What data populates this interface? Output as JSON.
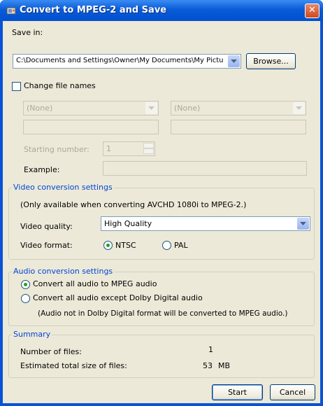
{
  "window": {
    "title": "Convert to MPEG-2 and Save"
  },
  "save_in": {
    "label": "Save in:",
    "path": "C:\\Documents and Settings\\Owner\\My Documents\\My Pictu",
    "browse_label": "Browse..."
  },
  "change_names": {
    "label": "Change file names",
    "checked": false
  },
  "naming": {
    "combo1_value": "(None)",
    "combo2_value": "(None)",
    "starting_number_label": "Starting number:",
    "starting_number_value": "1",
    "example_label": "Example:"
  },
  "video": {
    "group_label": "Video conversion settings",
    "note": "(Only available when converting AVCHD 1080i to MPEG-2.)",
    "quality_label": "Video quality:",
    "quality_value": "High Quality",
    "format_label": "Video format:",
    "ntsc_label": "NTSC",
    "pal_label": "PAL",
    "selected_format": "NTSC"
  },
  "audio": {
    "group_label": "Audio conversion settings",
    "option1_label": "Convert all audio to MPEG audio",
    "option2_label": "Convert all audio except Dolby Digital audio",
    "note": "(Audio not in Dolby Digital format will be converted to MPEG audio.)",
    "selected": "option1"
  },
  "summary": {
    "group_label": "Summary",
    "files_label": "Number of files:",
    "files_value": "1",
    "size_label": "Estimated total size of files:",
    "size_value": "53",
    "size_unit": "MB"
  },
  "buttons": {
    "start_label": "Start",
    "cancel_label": "Cancel"
  },
  "colors": {
    "title_bar": "#0a5bd8",
    "group_label": "#0046d5",
    "client_bg": "#ece9d8",
    "close": "#d04a20"
  }
}
